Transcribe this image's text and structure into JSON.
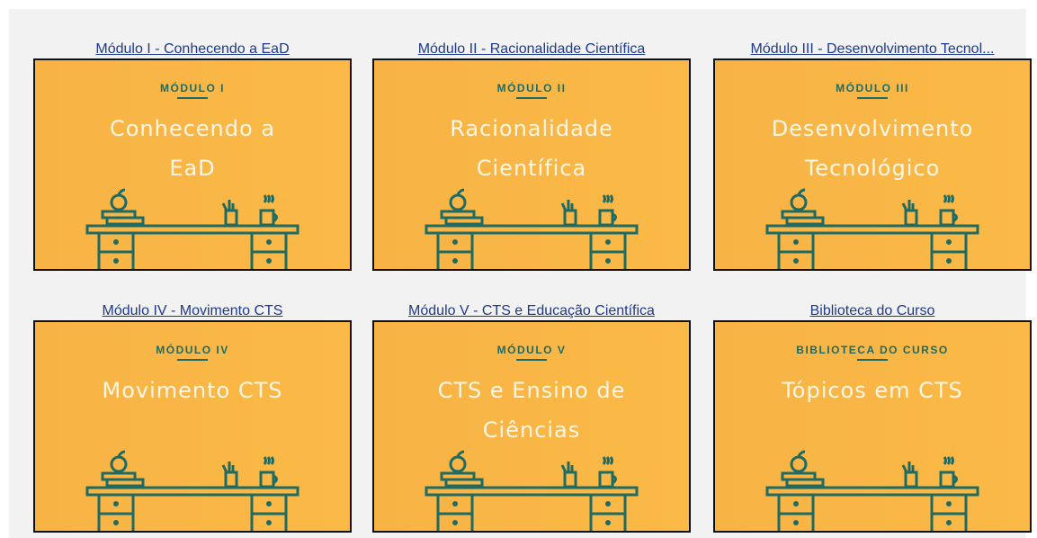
{
  "cards": [
    {
      "title": "Módulo I - Conhecendo a EaD",
      "kicker": "MÓDULO I",
      "line1": "Conhecendo a",
      "line2": "EaD"
    },
    {
      "title": "Módulo II - Racionalidade Científica",
      "kicker": "MÓDULO II",
      "line1": "Racionalidade",
      "line2": "Científica"
    },
    {
      "title": "Módulo III - Desenvolvimento Tecnol...",
      "kicker": "MÓDULO III",
      "line1": "Desenvolvimento",
      "line2": "Tecnológico"
    },
    {
      "title": "Módulo IV - Movimento CTS",
      "kicker": "MÓDULO IV",
      "line1": "Movimento CTS",
      "line2": ""
    },
    {
      "title": "Módulo V - CTS e Educação Científica",
      "kicker": "MÓDULO V",
      "line1": "CTS e Ensino de",
      "line2": "Ciências"
    },
    {
      "title": "Biblioteca do Curso",
      "kicker": "BIBLIOTECA DO CURSO",
      "line1": "Tópicos em CTS",
      "line2": ""
    }
  ],
  "colors": {
    "panel": "#f2f2f2",
    "link": "#1f3a8a",
    "card_bg": "#f9b646",
    "accent": "#1f6b63",
    "text_light": "#fff6e6"
  },
  "icons": [
    "apple-icon",
    "books-icon",
    "pencil-cup-icon",
    "coffee-mug-icon",
    "desk-illustration"
  ]
}
